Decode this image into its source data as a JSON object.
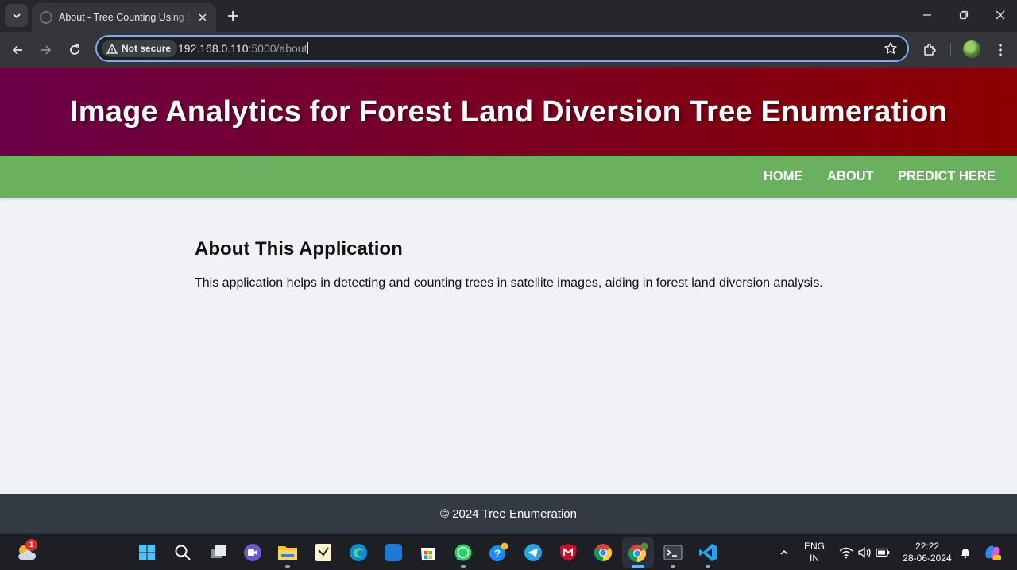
{
  "browser": {
    "tab_title": "About - Tree Counting Using Sa",
    "security_label": "Not secure",
    "url_host": "192.168.0.110",
    "url_path": ":5000/about"
  },
  "page": {
    "header_title": "Image Analytics for Forest Land Diversion Tree Enumeration",
    "nav": [
      {
        "label": "HOME"
      },
      {
        "label": "ABOUT"
      },
      {
        "label": "PREDICT HERE"
      }
    ],
    "content": {
      "heading": "About This Application",
      "body": "This application helps in detecting and counting trees in satellite images, aiding in forest land diversion analysis."
    },
    "footer": "© 2024 Tree Enumeration",
    "colors": {
      "header_start": "#6b0047",
      "header_end": "#8b0000",
      "nav_bg": "#6ab05e",
      "footer_bg": "#333a44",
      "page_bg": "#f1f2f6"
    }
  },
  "taskbar": {
    "weather_badge": "1",
    "apps": [
      "start-icon",
      "search-icon",
      "task-view-icon",
      "meet-icon",
      "file-explorer-icon",
      "notes-icon",
      "edge-icon",
      "myhp-icon",
      "store-icon",
      "whatsapp-icon",
      "help-icon",
      "telegram-icon",
      "mcafee-icon",
      "chrome-icon",
      "chrome-profile-icon",
      "terminal-icon",
      "vscode-icon"
    ],
    "language_line1": "ENG",
    "language_line2": "IN",
    "time": "22:22",
    "date": "28-06-2024"
  }
}
